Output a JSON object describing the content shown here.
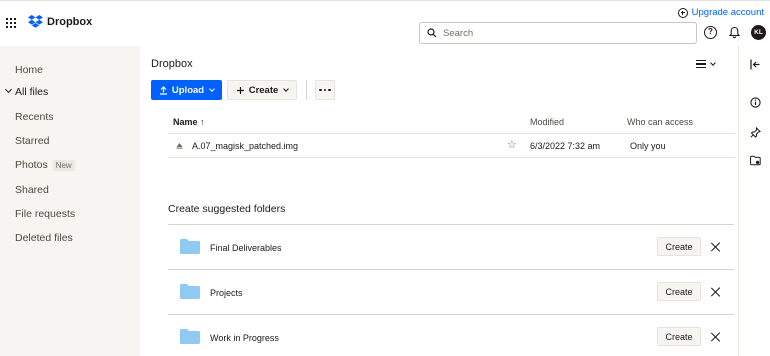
{
  "header": {
    "brand": "Dropbox",
    "upgrade": "Upgrade account",
    "search_placeholder": "Search",
    "avatar_initials": "KL"
  },
  "sidebar": {
    "items": [
      {
        "label": "Home"
      },
      {
        "label": "All files",
        "active": true
      },
      {
        "label": "Recents"
      },
      {
        "label": "Starred"
      },
      {
        "label": "Photos",
        "badge": "New"
      },
      {
        "label": "Shared"
      },
      {
        "label": "File requests"
      },
      {
        "label": "Deleted files"
      }
    ]
  },
  "main": {
    "breadcrumb": "Dropbox",
    "upload_label": "Upload",
    "create_label": "Create",
    "columns": {
      "name": "Name",
      "sort_indicator": "↑",
      "modified": "Modified",
      "access": "Who can access"
    },
    "files": [
      {
        "name": "A.07_magisk_patched.img",
        "modified": "6/3/2022 7:32 am",
        "access": "Only you"
      }
    ],
    "suggest": {
      "title": "Create suggested folders",
      "create_label": "Create",
      "folders": [
        "Final Deliverables",
        "Projects",
        "Work in Progress"
      ]
    }
  },
  "colors": {
    "accent": "#0061fe",
    "sidebar_bg": "#f7f5f2",
    "folder": "#8fcaf3"
  }
}
